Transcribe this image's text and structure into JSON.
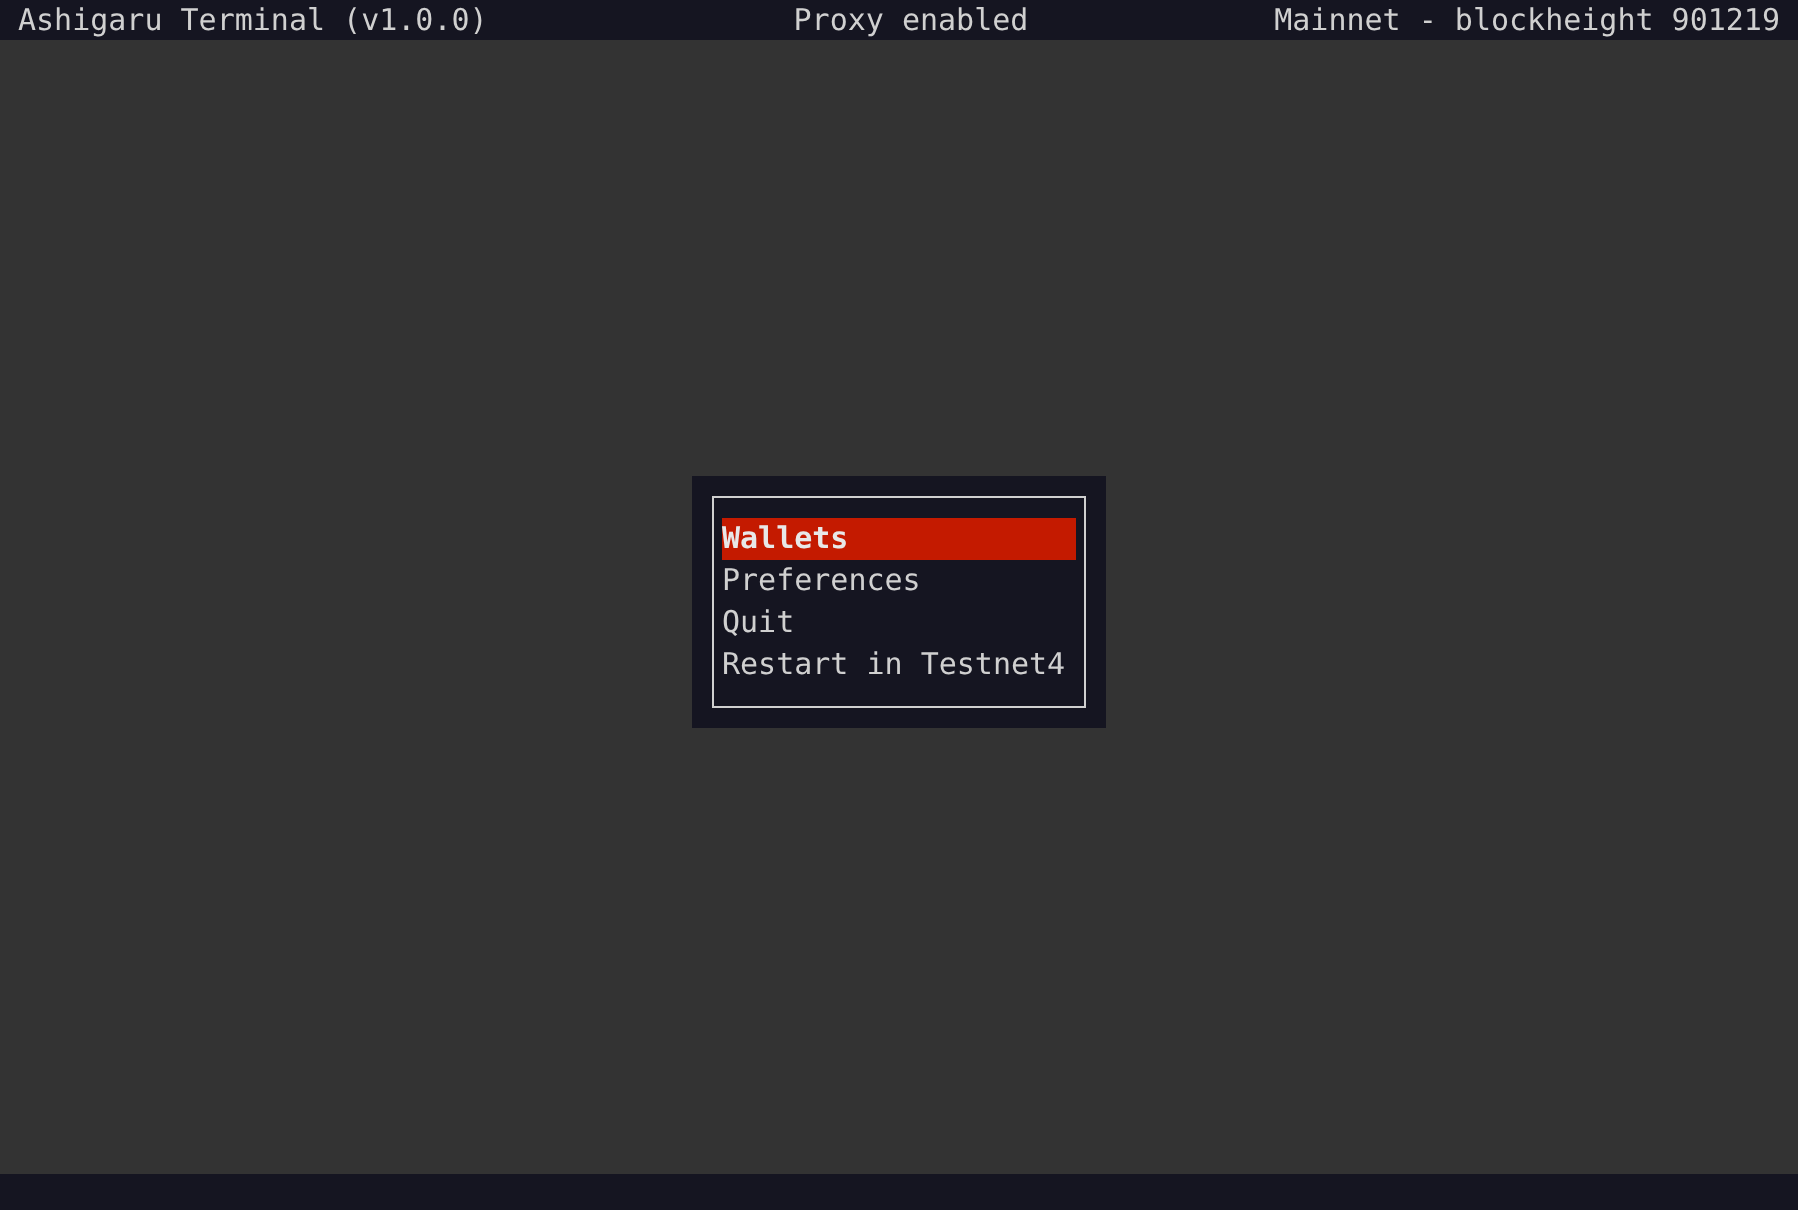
{
  "header": {
    "title": "Ashigaru Terminal (v1.0.0)",
    "proxy": "Proxy enabled",
    "network": "Mainnet - blockheight 901219"
  },
  "menu": {
    "items": [
      {
        "label": "Wallets",
        "selected": true
      },
      {
        "label": "Preferences",
        "selected": false
      },
      {
        "label": "Quit",
        "selected": false
      },
      {
        "label": "Restart in Testnet4",
        "selected": false
      }
    ]
  }
}
